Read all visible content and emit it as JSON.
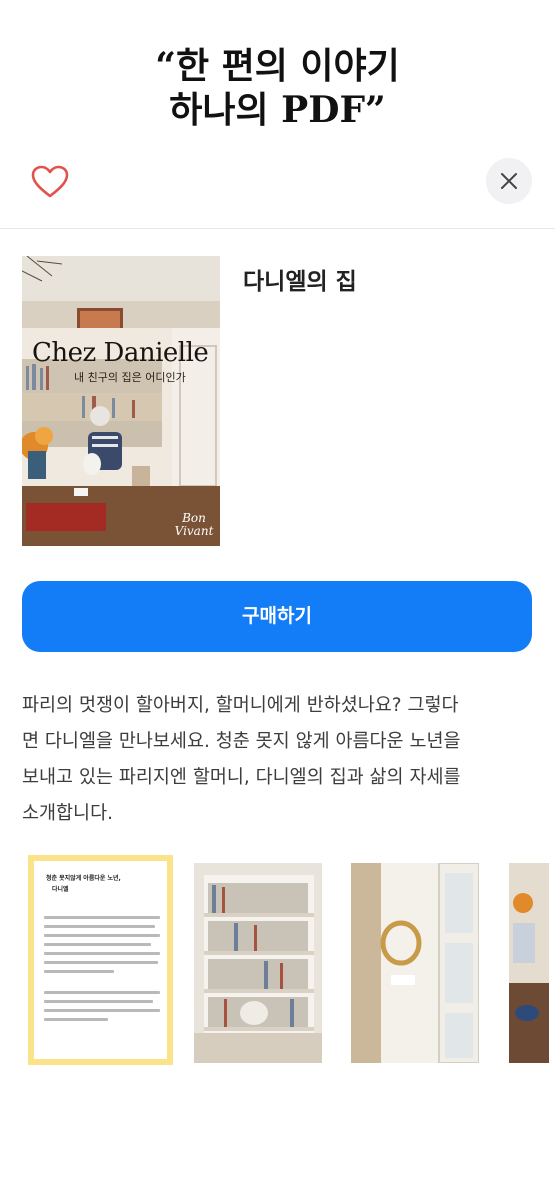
{
  "headline": {
    "line1": "“한 편의 이야기",
    "line2": "하나의 PDF”"
  },
  "sheet": {
    "heart_icon": "heart-outline-icon",
    "close_icon": "close-icon"
  },
  "book": {
    "title": "다니엘의 집",
    "cover": {
      "title": "Chez Danielle",
      "subtitle": "내 친구의 집은 어디인가",
      "brand_line1": "Bon",
      "brand_line2": "Vivant"
    }
  },
  "buy_button": {
    "label": "구매하기"
  },
  "description": {
    "line1": "파리의 멋쟁이 할아버지, 할머니에게 반하셨나요? 그렇다",
    "line2": "면 다니엘을 만나보세요. 청춘 못지 않게 아름다운 노년을",
    "line3": "보내고 있는 파리지엔 할머니, 다니엘의 집과 삶의 자세를",
    "line4": "소개합니다."
  },
  "preview": {
    "page_title": "청춘 못지않게 아름다운 노년,",
    "page_subtitle": "다니엘"
  },
  "colors": {
    "accent": "#137cf7",
    "heart": "#e2524c",
    "highlight": "#fbe38c"
  }
}
